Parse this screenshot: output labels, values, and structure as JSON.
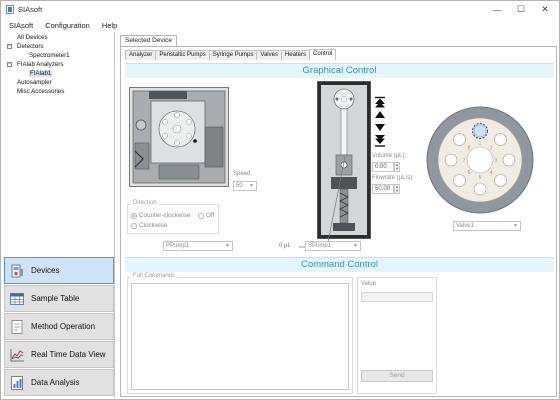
{
  "window": {
    "title": "SIAsoft",
    "minimize": "—",
    "maximize": "☐",
    "close": "✕"
  },
  "menu": [
    "SIAsoft",
    "Configuration",
    "Help"
  ],
  "tree": [
    {
      "label": "All Devices",
      "indent": 0
    },
    {
      "label": "Detectors",
      "indent": 0,
      "expander": "−"
    },
    {
      "label": "Spectrometer1",
      "indent": 2
    },
    {
      "label": "FIAlab Analyzers",
      "indent": 0,
      "expander": "−"
    },
    {
      "label": "FIAlab1",
      "indent": 2,
      "selected": true
    },
    {
      "label": "Autosampler",
      "indent": 0
    },
    {
      "label": "Misc Accessories",
      "indent": 0
    }
  ],
  "nav": [
    {
      "label": "Devices",
      "icon": "devices-icon",
      "active": true
    },
    {
      "label": "Sample Table",
      "icon": "table-icon"
    },
    {
      "label": "Method Operation",
      "icon": "method-icon"
    },
    {
      "label": "Real Time Data View",
      "icon": "chart-icon"
    },
    {
      "label": "Data Analysis",
      "icon": "analysis-icon"
    }
  ],
  "selected_device_tab": "Selected Device",
  "device_tabs": [
    "Analyzer",
    "Peristaltic Pumps",
    "Syringe Pumps",
    "Valves",
    "Heaters",
    "Control"
  ],
  "active_tab": "Control",
  "graphical_control": {
    "header": "Graphical Control",
    "speed_label": "Speed:",
    "speed_value": "50",
    "direction_title": "Direction",
    "direction_ccw": "Counter-clockwise",
    "direction_off": "Off",
    "direction_cw": "Clockwise",
    "peristaltic_select": "PPump1",
    "syringe_readout": "0 μL",
    "syringe_select": "SPump1",
    "volume_label": "Volume (μL):",
    "volume_value": "0.00",
    "flowrate_label": "Flowrate (μL/s):",
    "flowrate_value": "50.00",
    "valve_select": "Valve1",
    "valve_ports": [
      "1",
      "2",
      "3",
      "4",
      "5",
      "6",
      "7",
      "8"
    ]
  },
  "command_control": {
    "header": "Command Control",
    "full_commands_label": "Full Commands",
    "value_label": "Value",
    "send_label": "Send"
  },
  "colors": {
    "accent": "#2b9ab2",
    "band": "#e4f6f9",
    "nav_active": "#cce3f8"
  }
}
